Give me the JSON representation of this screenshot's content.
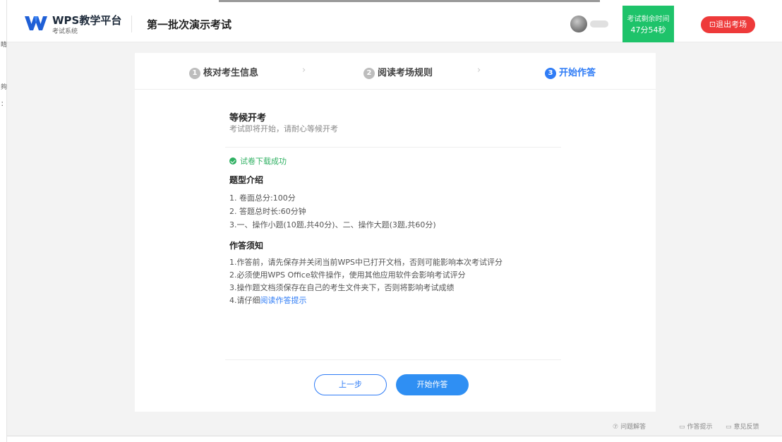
{
  "left_strip": {
    "chars": [
      "睛",
      "夠",
      "：!"
    ]
  },
  "header": {
    "logo_title": "WPS教学平台",
    "logo_subtitle": "考试系统",
    "exam_title": "第一批次演示考试",
    "timer_label": "考试剩余时间",
    "timer_value": "47分54秒",
    "exit_label": "⊡退出考场",
    "colors": {
      "timer_bg": "#1ec36a",
      "exit_bg": "#ee3a3a",
      "accent": "#2f7cf6"
    }
  },
  "steps": [
    {
      "num": "1",
      "label": "核对考生信息",
      "active": false
    },
    {
      "num": "2",
      "label": "阅读考场规则",
      "active": false
    },
    {
      "num": "3",
      "label": "开始作答",
      "active": true
    }
  ],
  "step_arrow": "›",
  "content": {
    "wait_title": "等候开考",
    "wait_sub": "考试即将开始，请耐心等候开考",
    "download_ok": "试卷下载成功",
    "types_title": "题型介绍",
    "types": [
      "1. 卷面总分:100分",
      "2. 答题总时长:60分钟",
      "3.一、操作小题(10题,共40分)、二、操作大题(3题,共60分)"
    ],
    "notice_title": "作答须知",
    "notices": [
      "1.作答前，请先保存并关闭当前WPS中已打开文档，否则可能影响本次考试评分",
      "2.必须使用WPS Office软件操作，使用其他应用软件会影响考试评分",
      "3.操作题文档须保存在自己的考生文件夹下，否则将影响考试成绩"
    ],
    "notice4_prefix": "4.请仔细",
    "notice4_link": "阅读作答提示"
  },
  "buttons": {
    "prev": "上一步",
    "start": "开始作答"
  },
  "footer": [
    {
      "icon": "question-icon",
      "glyph": "⑦",
      "label": "问题解答"
    },
    {
      "icon": "monitor-icon",
      "glyph": "▭",
      "label": "作答提示"
    },
    {
      "icon": "message-icon",
      "glyph": "▭",
      "label": "意见反馈"
    }
  ]
}
